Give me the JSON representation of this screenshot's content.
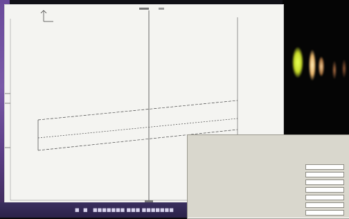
{
  "desktop": {
    "taskbar_items": [
      "■",
      "■",
      "■■■■■■■ ■■■ ■■■■■■■"
    ]
  },
  "plot": {
    "top_tick_label": "",
    "bottom_tick_label": "",
    "corner_label": "",
    "left_labels": [
      "",
      ""
    ]
  },
  "dialog": {
    "header_line1": "",
    "header_line2": "",
    "columns": [
      "",
      "",
      "",
      ""
    ],
    "rows": [
      {
        "name": "",
        "c2": "",
        "c3": "",
        "value": ""
      },
      {
        "name": "",
        "c2": "",
        "c3": "",
        "value": ""
      },
      {
        "name": "",
        "c2": "",
        "c3": "",
        "value": ""
      },
      {
        "name": "",
        "c2": "",
        "c3": "",
        "value": ""
      },
      {
        "name": "",
        "c2": "",
        "c3": "",
        "value": ""
      },
      {
        "name": "",
        "c2": "",
        "c3": "",
        "value": ""
      },
      {
        "name": "",
        "c2": "",
        "c3": "",
        "value": ""
      }
    ]
  },
  "colors": {
    "desktop_purple": "#6a4a9a",
    "taskbar": "#2b2249",
    "glow_yellow": "#d9f03a",
    "glow_warm": "#f3d59a"
  }
}
